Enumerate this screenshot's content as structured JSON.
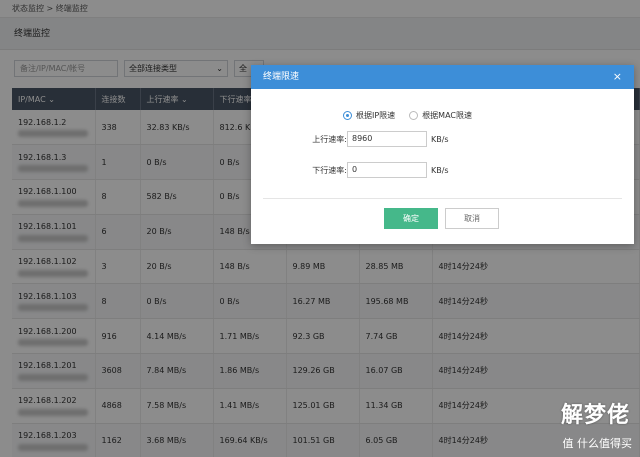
{
  "breadcrumb": "状态监控 > 终端监控",
  "page_title": "终端监控",
  "filters": {
    "search_placeholder": "备注/IP/MAC/帐号",
    "connection_type": "全部连接类型",
    "third": "全"
  },
  "table": {
    "headers": [
      "IP/MAC",
      "连接数",
      "上行速率",
      "下行速率",
      "",
      "",
      ""
    ],
    "rows": [
      [
        "192.168.1.2",
        "338",
        "32.83 KB/s",
        "812.6 KB/s",
        "",
        "",
        ""
      ],
      [
        "192.168.1.3",
        "1",
        "0 B/s",
        "0 B/s",
        "",
        "",
        ""
      ],
      [
        "192.168.1.100",
        "8",
        "582 B/s",
        "0 B/s",
        "",
        "",
        ""
      ],
      [
        "192.168.1.101",
        "6",
        "20 B/s",
        "148 B/s",
        "",
        "",
        ""
      ],
      [
        "192.168.1.102",
        "3",
        "20 B/s",
        "148 B/s",
        "9.89 MB",
        "28.85 MB",
        "4时14分24秒"
      ],
      [
        "192.168.1.103",
        "8",
        "0 B/s",
        "0 B/s",
        "16.27 MB",
        "195.68 MB",
        "4时14分24秒"
      ],
      [
        "192.168.1.200",
        "916",
        "4.14 MB/s",
        "1.71 MB/s",
        "92.3 GB",
        "7.74 GB",
        "4时14分24秒"
      ],
      [
        "192.168.1.201",
        "3608",
        "7.84 MB/s",
        "1.86 MB/s",
        "129.26 GB",
        "16.07 GB",
        "4时14分24秒"
      ],
      [
        "192.168.1.202",
        "4868",
        "7.58 MB/s",
        "1.41 MB/s",
        "125.01 GB",
        "11.34 GB",
        "4时14分24秒"
      ],
      [
        "192.168.1.203",
        "1162",
        "3.68 MB/s",
        "169.64 KB/s",
        "101.51 GB",
        "6.05 GB",
        "4时14分24秒"
      ]
    ]
  },
  "modal": {
    "title": "终端限速",
    "close": "×",
    "radio_ip": "根据IP限速",
    "radio_mac": "根据MAC限速",
    "upload_label": "上行速率:",
    "upload_value": "8960",
    "upload_unit": "KB/s",
    "download_label": "下行速率:",
    "download_value": "0",
    "download_unit": "KB/s",
    "ok": "确定",
    "cancel": "取消"
  },
  "watermark": {
    "line1": "解梦佬",
    "line2": "值 什么值得买"
  },
  "colors": {
    "header_blue": "#3d8ed8",
    "ok_green": "#45b88a",
    "table_head": "#4a5666"
  }
}
